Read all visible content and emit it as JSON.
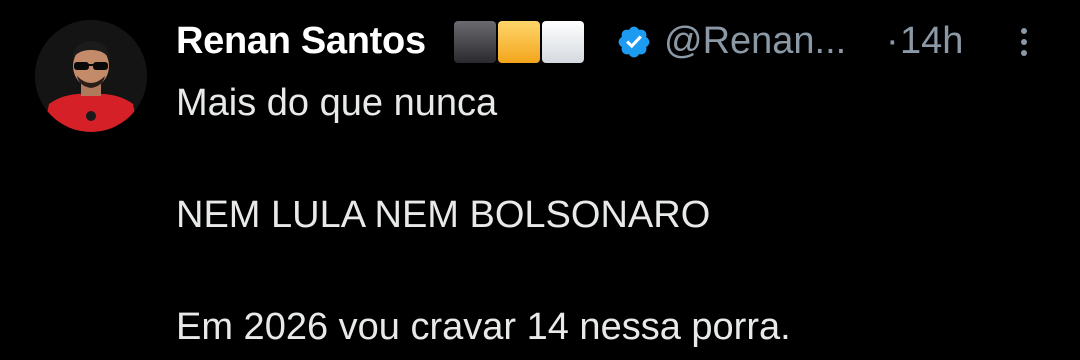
{
  "tweet": {
    "author": {
      "name": "Renan Santos",
      "handle": "@Renan...",
      "flags": [
        "black-flag",
        "yellow-flag",
        "white-flag"
      ],
      "verified_icon": "verified-badge-icon",
      "avatar": "avatar"
    },
    "time": "14h",
    "dot": "·",
    "more_icon": "more-options-icon",
    "lines": [
      "Mais do que nunca",
      "",
      "NEM LULA NEM BOLSONARO",
      "",
      "Em 2026 vou cravar 14 nessa porra."
    ]
  },
  "colors": {
    "background": "#000000",
    "name": "#ffffff",
    "secondary": "#8b98a5",
    "text": "#e7e9ea",
    "verified": "#1d9bf0",
    "avatar_shirt": "#d42026"
  }
}
